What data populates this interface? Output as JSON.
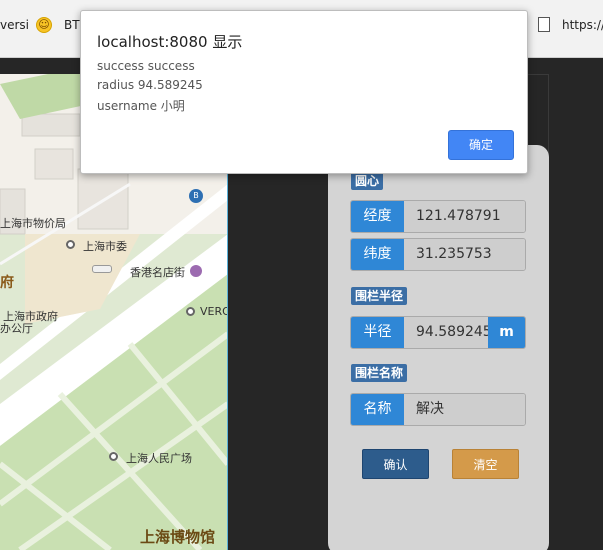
{
  "browser": {
    "bookmark_1": "versi",
    "bookmark_2": "BT",
    "bookmark_3": "https://"
  },
  "map": {
    "labels": {
      "municipal_price_bureau": "上海市物价局",
      "municipal_committee": "上海市委",
      "hongkong_street": "香港名店街",
      "fu": "府",
      "gov_office_line1": "上海市政府",
      "gov_office_line2": "办公厅",
      "vero": "VERO",
      "peoples_square": "上海人民广场",
      "museum": "上海博物馆"
    }
  },
  "form": {
    "center_tag": "圆心",
    "lng_label": "经度",
    "lng_value": "121.478791",
    "lat_label": "纬度",
    "lat_value": "31.235753",
    "radius_tag": "围栏半径",
    "radius_label": "半径",
    "radius_value": "94.589245",
    "radius_unit": "m",
    "name_tag": "围栏名称",
    "name_label": "名称",
    "name_value": "解决",
    "confirm_button": "确认",
    "clear_button": "清空"
  },
  "dialog": {
    "title": "localhost:8080 显示",
    "line1": "success success",
    "line2": "radius 94.589245",
    "line3": "username 小明",
    "ok_button": "确定"
  },
  "colors": {
    "primary_blue": "#2f87d6",
    "tag_blue": "#3b6ea5",
    "confirm_blue": "#2d5c8c",
    "clear_orange": "#d49a4a",
    "dialog_ok_blue": "#4286f5"
  }
}
